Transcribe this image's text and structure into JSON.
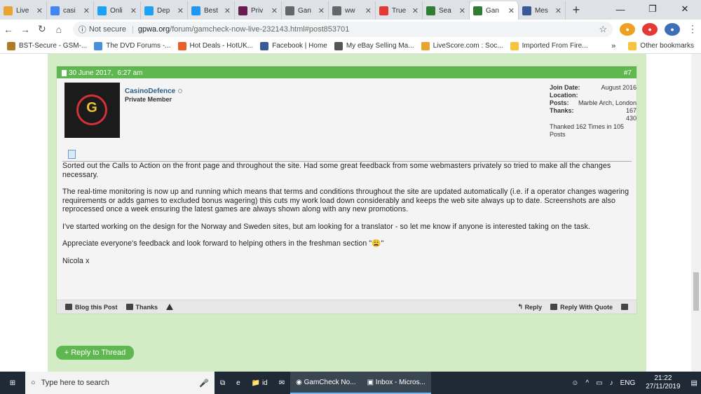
{
  "browser": {
    "tabs": [
      {
        "label": "Live",
        "fav": "#e8a330",
        "active": false
      },
      {
        "label": "casi",
        "fav": "#4285f4",
        "active": false
      },
      {
        "label": "Onli",
        "fav": "#1da1f2",
        "active": false
      },
      {
        "label": "Dep",
        "fav": "#1da1f2",
        "active": false
      },
      {
        "label": "Best",
        "fav": "#2196f3",
        "active": false
      },
      {
        "label": "Priv",
        "fav": "#6a1b4d",
        "active": false
      },
      {
        "label": "Gan",
        "fav": "#666666",
        "active": false
      },
      {
        "label": "ww",
        "fav": "#666666",
        "active": false
      },
      {
        "label": "True",
        "fav": "#e53935",
        "active": false
      },
      {
        "label": "Sea",
        "fav": "#2e7d32",
        "active": false
      },
      {
        "label": "Gan",
        "fav": "#2e7d32",
        "active": true
      },
      {
        "label": "Mes",
        "fav": "#3b5998",
        "active": false
      }
    ],
    "new_tab": "+",
    "window_controls": {
      "minimize": "—",
      "maximize": "❐",
      "close": "✕"
    },
    "address": {
      "security": "Not secure",
      "host": "gpwa.org",
      "path": "/forum/gamcheck-now-live-232143.html#post853701"
    },
    "bookmarks": [
      {
        "label": "BST-Secure - GSM-...",
        "color": "#b07a2a"
      },
      {
        "label": "The DVD Forums -...",
        "color": "#4a90d9"
      },
      {
        "label": "Hot Deals - HotUK...",
        "color": "#e85d2a"
      },
      {
        "label": "Facebook | Home",
        "color": "#3b5998"
      },
      {
        "label": "My eBay Selling Ma...",
        "color": "#555555"
      },
      {
        "label": "LiveScore.com : Soc...",
        "color": "#e8a330"
      },
      {
        "label": "Imported From Fire...",
        "color": "#f5c542"
      }
    ],
    "bookmarks_more": "»",
    "other_bookmarks": "Other bookmarks"
  },
  "post": {
    "date": "30 June 2017,",
    "time": "6:27 am",
    "number": "#7",
    "user": {
      "name": "CasinoDefence",
      "rank": "Private Member",
      "avatar_letter": "G"
    },
    "info": {
      "join_label": "Join Date:",
      "join_value": "August 2016",
      "location_label": "Location:",
      "posts_label": "Posts:",
      "posts_value": "Marble Arch, London",
      "thanks_label": "Thanks:",
      "thanks_value": "167",
      "thanks_extra": "430",
      "thanked": "Thanked 162 Times in 105 Posts"
    },
    "body": [
      "Sorted out the Calls to Action on the front page and throughout the site. Had some great feedback from some webmasters privately so tried to make all the changes necessary.",
      "The real-time monitoring is now up and running which means that terms and conditions throughout the site are updated automatically (i.e. if a operator changes wagering requirements or adds games to excluded bonus wagering) this cuts my work load down considerably and keeps the web site always up to date. Screenshots are also reprocessed once a week ensuring the latest games are always shown along with any new promotions.",
      "I've started working on the design for the Norway and Sweden sites, but am looking for a translator - so let me know if anyone is interested taking on the task.",
      "Appreciate everyone's feedback and look forward to helping others in the freshman section \"😩\"",
      "Nicola x"
    ],
    "footer": {
      "blog": "Blog this Post",
      "thanks": "Thanks",
      "reply": "Reply",
      "reply_quote": "Reply With Quote"
    }
  },
  "reply_to_thread": "+ Reply to Thread",
  "taskbar": {
    "search_placeholder": "Type here to search",
    "items": [
      "id",
      "GamCheck No...",
      "Inbox - Micros..."
    ],
    "lang": "ENG",
    "time": "21:22",
    "date": "27/11/2019"
  }
}
